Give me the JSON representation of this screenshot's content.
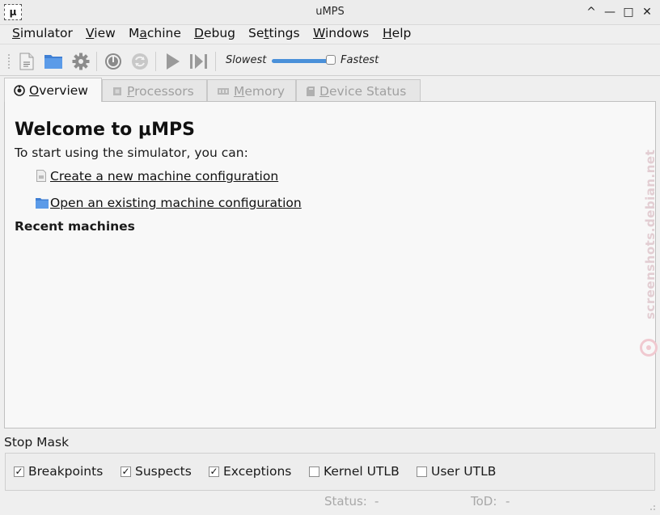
{
  "window": {
    "title": "uMPS",
    "app_icon_glyph": "μ"
  },
  "window_controls": [
    "^",
    "—",
    "□",
    "✕"
  ],
  "menubar": [
    {
      "pre": "",
      "u": "S",
      "post": "imulator"
    },
    {
      "pre": "",
      "u": "V",
      "post": "iew"
    },
    {
      "pre": "M",
      "u": "a",
      "post": "chine"
    },
    {
      "pre": "",
      "u": "D",
      "post": "ebug"
    },
    {
      "pre": "Se",
      "u": "t",
      "post": "tings"
    },
    {
      "pre": "",
      "u": "W",
      "post": "indows"
    },
    {
      "pre": "",
      "u": "H",
      "post": "elp"
    }
  ],
  "toolbar": {
    "icons": [
      "new-config-icon",
      "open-config-icon",
      "settings-icon",
      "power-icon",
      "reset-icon",
      "run-icon",
      "step-icon"
    ],
    "speed": {
      "min_label": "Slowest",
      "max_label": "Fastest",
      "value": 1.0
    },
    "accent_color": "#4a90d9"
  },
  "tabs": [
    {
      "pre": "",
      "u": "O",
      "post": "verview",
      "active": true
    },
    {
      "pre": "",
      "u": "P",
      "post": "rocessors",
      "active": false
    },
    {
      "pre": "",
      "u": "M",
      "post": "emory",
      "active": false
    },
    {
      "pre": "",
      "u": "D",
      "post": "evice Status",
      "active": false
    }
  ],
  "overview": {
    "title": "Welcome to μMPS",
    "intro": "To start using the simulator, you can:",
    "create_link": "Create a new machine configuration",
    "open_link": "Open an existing machine configuration",
    "recent_heading": "Recent machines"
  },
  "watermark": "screenshots.debian.net",
  "stop_mask": {
    "label": "Stop Mask",
    "options": [
      {
        "label": "Breakpoints",
        "checked": true
      },
      {
        "label": "Suspects",
        "checked": true
      },
      {
        "label": "Exceptions",
        "checked": true
      },
      {
        "label": "Kernel UTLB",
        "checked": false
      },
      {
        "label": "User UTLB",
        "checked": false
      }
    ]
  },
  "statusbar": {
    "status_label": "Status:",
    "status_value": "-",
    "tod_label": "ToD:",
    "tod_value": "-"
  }
}
